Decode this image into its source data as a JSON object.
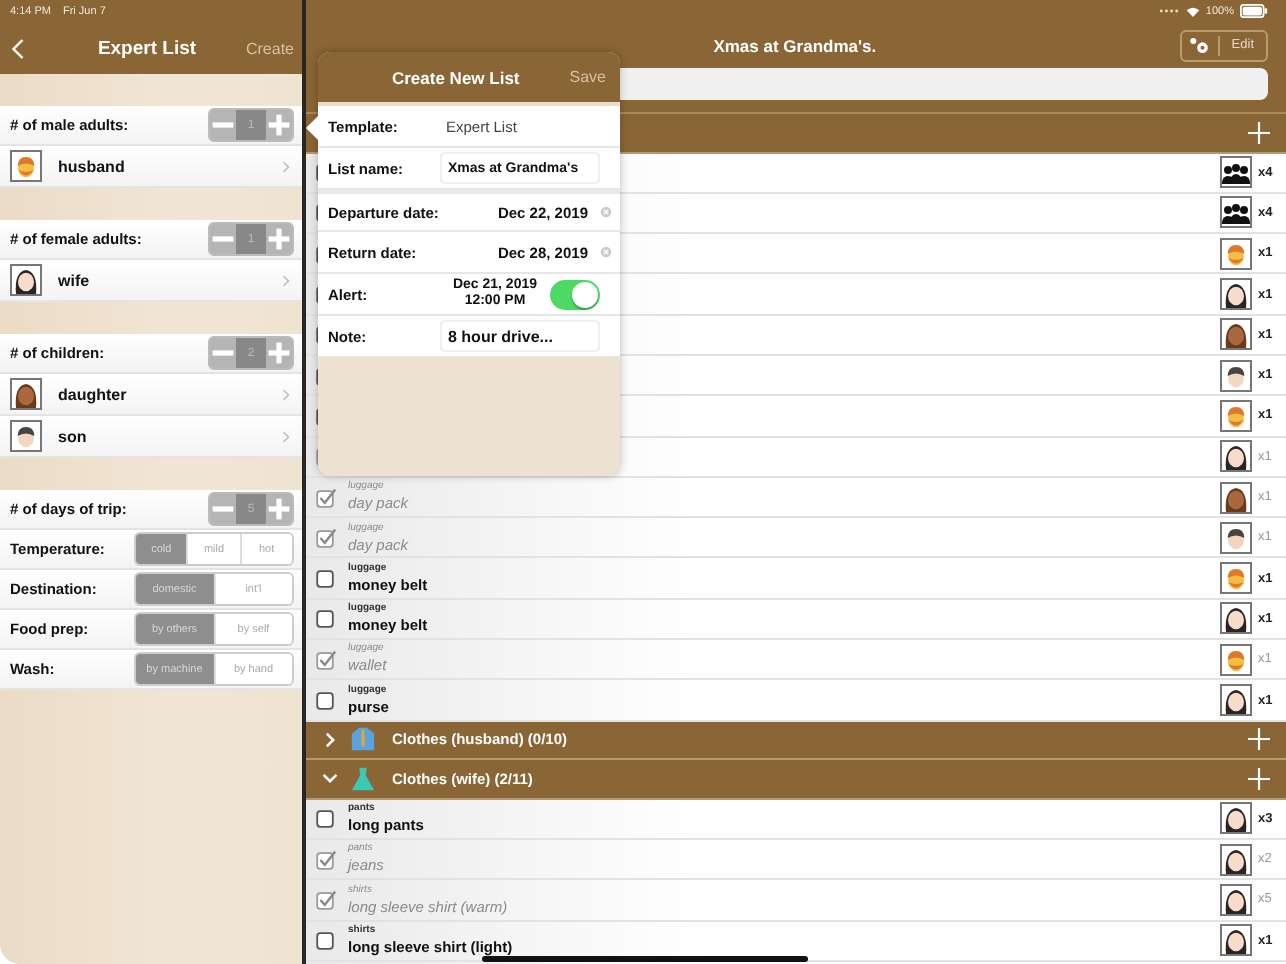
{
  "left_panel": {
    "status": {
      "time": "4:14 PM",
      "date": "Fri Jun 7"
    },
    "nav": {
      "title": "Expert List",
      "action": "Create"
    },
    "groups": [
      {
        "label": "# of male adults:",
        "value": "1",
        "people": [
          {
            "name": "husband",
            "kind": "man"
          }
        ]
      },
      {
        "label": "# of female adults:",
        "value": "1",
        "people": [
          {
            "name": "wife",
            "kind": "woman"
          }
        ]
      },
      {
        "label": "# of children:",
        "value": "2",
        "people": [
          {
            "name": "daughter",
            "kind": "girl"
          },
          {
            "name": "son",
            "kind": "boy"
          }
        ]
      }
    ],
    "days": {
      "label": "# of days of trip:",
      "value": "5"
    },
    "options": [
      {
        "label": "Temperature:",
        "segments": [
          {
            "label": "cold",
            "selected": true
          },
          {
            "label": "mild",
            "selected": false
          },
          {
            "label": "hot",
            "selected": false
          }
        ]
      },
      {
        "label": "Destination:",
        "segments": [
          {
            "label": "domestic",
            "selected": true
          },
          {
            "label": "int'l",
            "selected": false
          }
        ]
      },
      {
        "label": "Food prep:",
        "segments": [
          {
            "label": "by others",
            "selected": true
          },
          {
            "label": "by self",
            "selected": false
          }
        ]
      },
      {
        "label": "Wash:",
        "segments": [
          {
            "label": "by machine",
            "selected": true
          },
          {
            "label": "by hand",
            "selected": false
          }
        ]
      }
    ]
  },
  "main": {
    "status": {
      "battery": "100%"
    },
    "nav": {
      "title": "Xmas at Grandma's.",
      "action": "Edit"
    },
    "sections": [
      {
        "rows": [
          {
            "checked": false,
            "kind": "group",
            "count": "x4"
          },
          {
            "checked": false,
            "kind": "group",
            "count": "x4"
          },
          {
            "checked": false,
            "kind": "man",
            "count": "x1"
          },
          {
            "checked": false,
            "kind": "woman",
            "count": "x1"
          },
          {
            "checked": false,
            "kind": "girl",
            "count": "x1"
          },
          {
            "checked": false,
            "kind": "boy",
            "count": "x1"
          },
          {
            "checked": false,
            "kind": "man",
            "count": "x1"
          },
          {
            "checked": true,
            "kind": "woman",
            "count": "x1"
          },
          {
            "category": "luggage",
            "name": "day pack",
            "checked": true,
            "kind": "girl",
            "count": "x1"
          },
          {
            "category": "luggage",
            "name": "day pack",
            "checked": true,
            "kind": "boy",
            "count": "x1"
          },
          {
            "category": "luggage",
            "name": "money belt",
            "checked": false,
            "kind": "man",
            "count": "x1"
          },
          {
            "category": "luggage",
            "name": "money belt",
            "checked": false,
            "kind": "woman",
            "count": "x1"
          },
          {
            "category": "luggage",
            "name": "wallet",
            "checked": true,
            "kind": "man",
            "count": "x1"
          },
          {
            "category": "luggage",
            "name": "purse",
            "checked": false,
            "kind": "woman",
            "count": "x1"
          }
        ]
      },
      {
        "title": "Clothes (husband) (0/10)",
        "kind": "shirt",
        "expanded": false
      },
      {
        "title": "Clothes (wife) (2/11)",
        "kind": "dress",
        "expanded": true,
        "rows": [
          {
            "category": "pants",
            "name": "long pants",
            "checked": false,
            "kind": "woman",
            "count": "x3"
          },
          {
            "category": "pants",
            "name": "jeans",
            "checked": true,
            "kind": "woman",
            "count": "x2"
          },
          {
            "category": "shirts",
            "name": "long sleeve shirt (warm)",
            "checked": true,
            "kind": "woman",
            "count": "x5"
          },
          {
            "category": "shirts",
            "name": "long sleeve shirt (light)",
            "checked": false,
            "kind": "woman",
            "count": "x1"
          }
        ]
      }
    ]
  },
  "popover": {
    "title": "Create New List",
    "action": "Save",
    "template": {
      "label": "Template:",
      "value": "Expert List"
    },
    "list_name": {
      "label": "List name:",
      "value": "Xmas at Grandma's"
    },
    "departure": {
      "label": "Departure date:",
      "value": "Dec 22, 2019"
    },
    "return": {
      "label": "Return date:",
      "value": "Dec 28, 2019"
    },
    "alert": {
      "label": "Alert:",
      "date": "Dec 21, 2019",
      "time": "12:00 PM",
      "on": true
    },
    "note": {
      "label": "Note:",
      "value": "8 hour drive..."
    }
  }
}
